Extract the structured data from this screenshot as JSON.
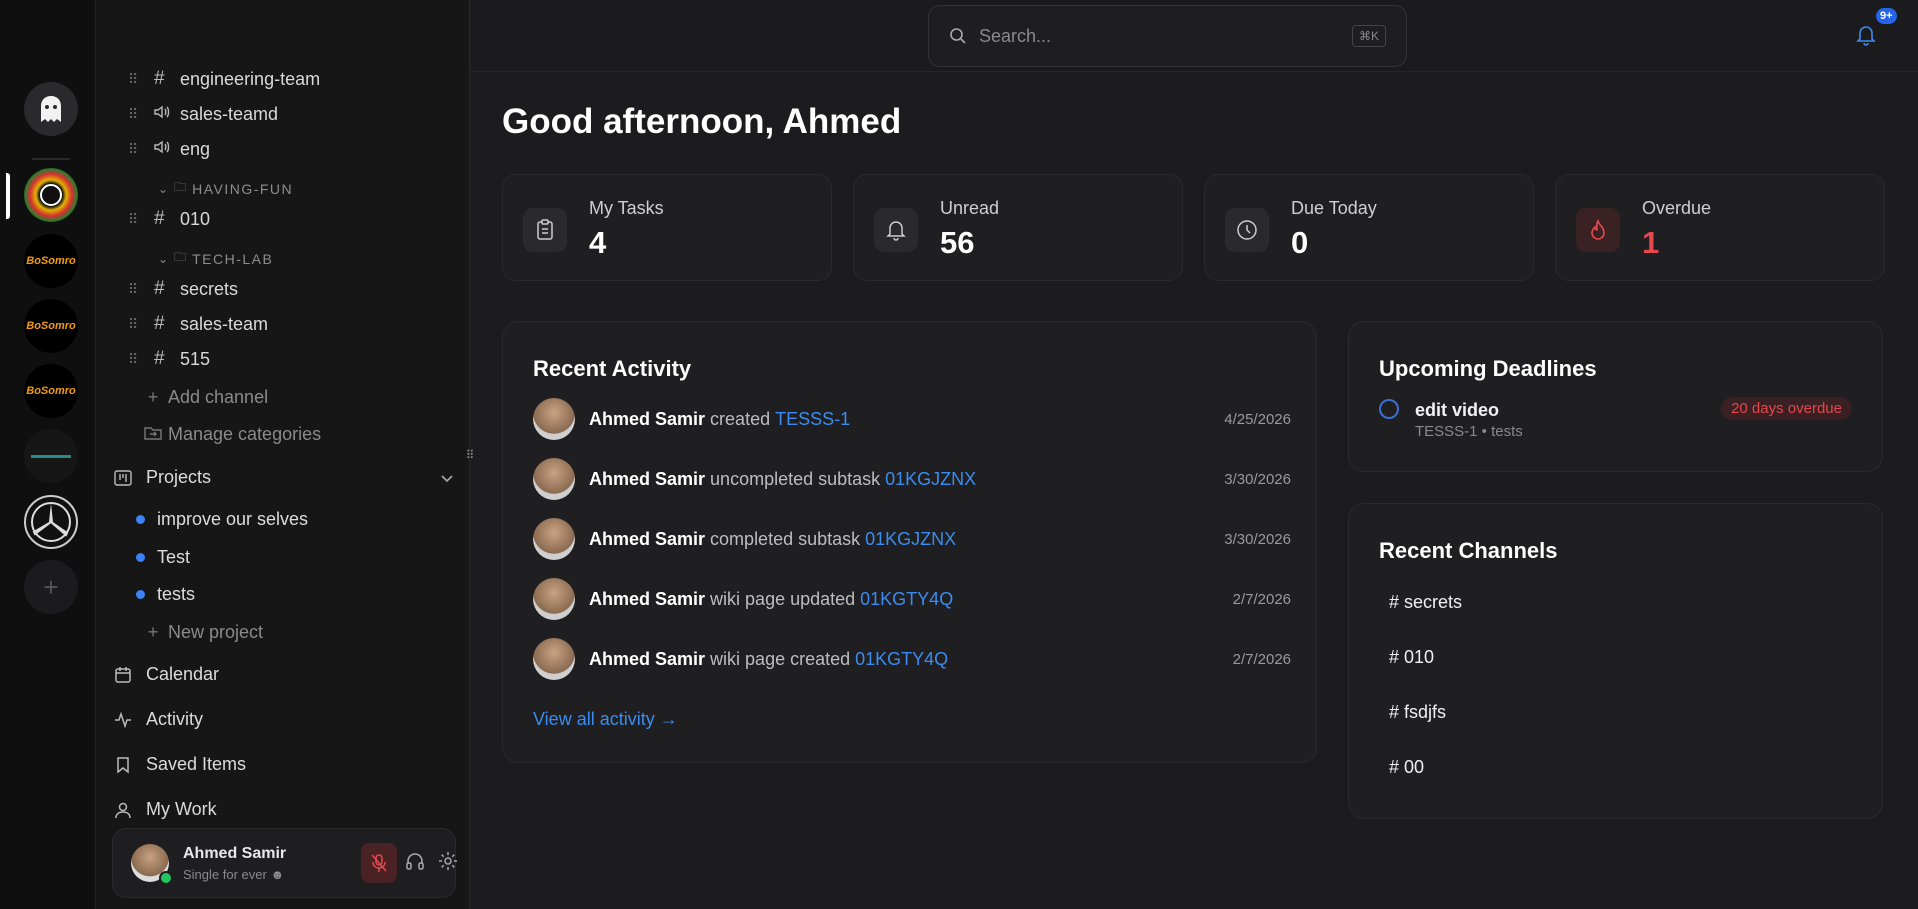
{
  "channels": [
    {
      "icon": "#",
      "name": "engineering-team"
    },
    {
      "icon": "speaker",
      "name": "sales-teamd"
    },
    {
      "icon": "speaker",
      "name": "eng"
    },
    {
      "category": "HAVING-FUN"
    },
    {
      "icon": "#",
      "name": "010"
    },
    {
      "category": "TECH-LAB"
    },
    {
      "icon": "#",
      "name": "secrets"
    },
    {
      "icon": "#",
      "name": "sales-team"
    },
    {
      "icon": "#",
      "name": "515"
    }
  ],
  "sidebar": {
    "add_channel": "Add channel",
    "manage_categories": "Manage categories",
    "projects_label": "Projects",
    "projects": [
      "improve our selves",
      "Test",
      "tests"
    ],
    "new_project": "New project",
    "nav": [
      "Calendar",
      "Activity",
      "Saved Items",
      "My Work"
    ]
  },
  "user": {
    "name": "Ahmed Samir",
    "status": "Single for ever"
  },
  "search": {
    "placeholder": "Search...",
    "shortcut": "⌘K"
  },
  "notifications": {
    "badge": "9+"
  },
  "greeting": "Good afternoon, Ahmed",
  "stats": [
    {
      "label": "My Tasks",
      "value": "4"
    },
    {
      "label": "Unread",
      "value": "56"
    },
    {
      "label": "Due Today",
      "value": "0"
    },
    {
      "label": "Overdue",
      "value": "1"
    }
  ],
  "recent_activity": {
    "title": "Recent Activity",
    "items": [
      {
        "who": "Ahmed Samir",
        "verb": "created",
        "ref": "TESSS-1",
        "date": "4/25/2026"
      },
      {
        "who": "Ahmed Samir",
        "verb": "uncompleted subtask",
        "ref": "01KGJZNX",
        "date": "3/30/2026"
      },
      {
        "who": "Ahmed Samir",
        "verb": "completed subtask",
        "ref": "01KGJZNX",
        "date": "3/30/2026"
      },
      {
        "who": "Ahmed Samir",
        "verb": "wiki page updated",
        "ref": "01KGTY4Q",
        "date": "2/7/2026"
      },
      {
        "who": "Ahmed Samir",
        "verb": "wiki page created",
        "ref": "01KGTY4Q",
        "date": "2/7/2026"
      }
    ],
    "view_all": "View all activity →"
  },
  "deadlines": {
    "title": "Upcoming Deadlines",
    "items": [
      {
        "task": "edit video",
        "meta": "TESSS-1 • tests",
        "badge": "20 days overdue"
      }
    ]
  },
  "recent_channels": {
    "title": "Recent Channels",
    "items": [
      "# secrets",
      "# 010",
      "# fsdjfs",
      "# 00"
    ]
  },
  "colors": {
    "accent": "#3b8cf0",
    "danger": "#e5484d",
    "project_dot": "#3b82f6",
    "online": "#22c55e"
  }
}
